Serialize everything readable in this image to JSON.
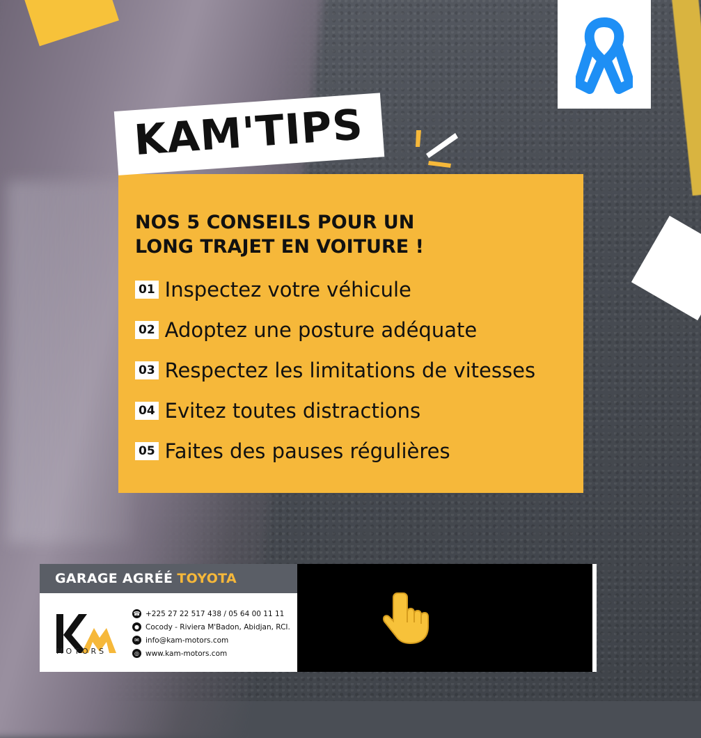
{
  "title": "KAM'TIPS",
  "heading": {
    "line1": "NOS 5 CONSEILS POUR UN",
    "line2": "LONG TRAJET EN VOITURE !"
  },
  "tips": [
    {
      "number": "01",
      "text": "Inspectez votre véhicule"
    },
    {
      "number": "02",
      "text": "Adoptez une posture adéquate"
    },
    {
      "number": "03",
      "text": "Respectez les limitations de vitesses"
    },
    {
      "number": "04",
      "text": "Evitez toutes distractions"
    },
    {
      "number": "05",
      "text": "Faites des pauses régulières"
    }
  ],
  "footer": {
    "garage_label": "GARAGE AGRÉÉ",
    "garage_brand": "TOYOTA",
    "logo_text": "KM",
    "logo_subtext": "MOTORS",
    "contacts": {
      "phone": "+225 27 22 517 438 / 05 64 00 11 11",
      "address": "Cocody - Riviera M'Badon, Abidjan, RCI.",
      "email": "info@kam-motors.com",
      "website": "www.kam-motors.com"
    },
    "icons": [
      "phone-icon",
      "location-pin-icon",
      "email-icon",
      "globe-icon",
      "pointing-hand-icon"
    ]
  },
  "colors": {
    "accent_yellow": "#f6b83a",
    "ribbon_blue": "#1e8ff5",
    "dark": "#111111",
    "footer_gray": "#5a5e66"
  },
  "decor_icons": [
    "awareness-ribbon-icon",
    "burst-lines-icon"
  ]
}
